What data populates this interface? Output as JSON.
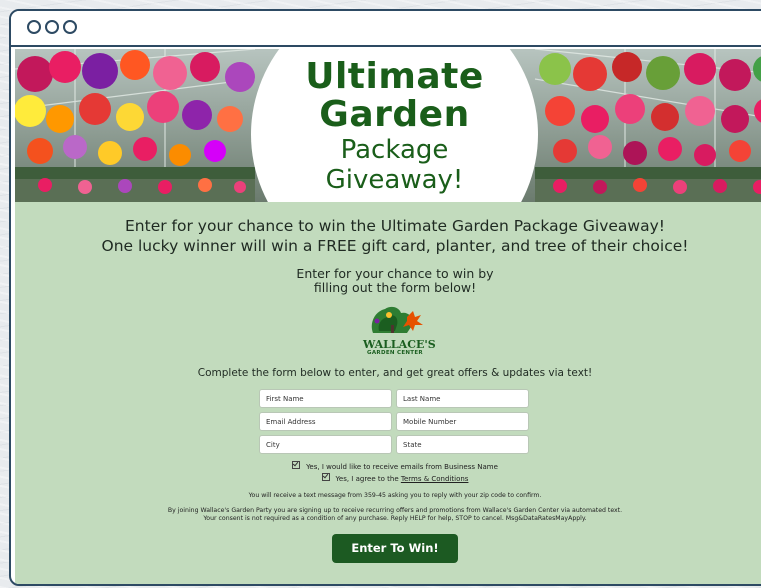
{
  "window": {
    "title": ""
  },
  "banner": {
    "title_line1": "Ultimate",
    "title_line2": "Garden",
    "title_line3": "Package",
    "title_line4": "Giveaway!"
  },
  "intro": {
    "line1": "Enter for your chance to win the Ultimate Garden Package Giveaway!",
    "line2": "One lucky winner will win a FREE gift card, planter, and tree of their choice!"
  },
  "sub": {
    "line1": "Enter for your chance to win by",
    "line2": "filling out the form below!"
  },
  "logo": {
    "name": "WALLACE'S",
    "tagline": "GARDEN CENTER"
  },
  "complete_text": "Complete the form below to enter, and get great offers & updates via text!",
  "form": {
    "first_name_placeholder": "First Name",
    "last_name_placeholder": "Last Name",
    "email_placeholder": "Email Address",
    "mobile_placeholder": "Mobile Number",
    "city_placeholder": "City",
    "state_placeholder": "State"
  },
  "checks": {
    "emails_label": "Yes, I would like to receive emails from Business Name",
    "agree_prefix": "Yes, I agree to the ",
    "terms_link": "Terms & Conditions"
  },
  "sms_notice": "You will receive a text message from 359-45 asking you to reply with your zip code to confirm.",
  "legal": {
    "line1": "By joining Wallace's Garden Party you are signing up to receive recurring offers and promotions from Wallace's Garden Center via automated text.",
    "line2": "Your consent is not required as a condition of any purchase. Reply HELP for help, STOP to cancel. Msg&DataRatesMayApply."
  },
  "button": {
    "label": "Enter To Win!"
  },
  "colors": {
    "page_bg": "#c2dbbd",
    "title_green": "#1a5e1a",
    "button_green": "#1c5a22",
    "frame": "#2d4a63"
  }
}
